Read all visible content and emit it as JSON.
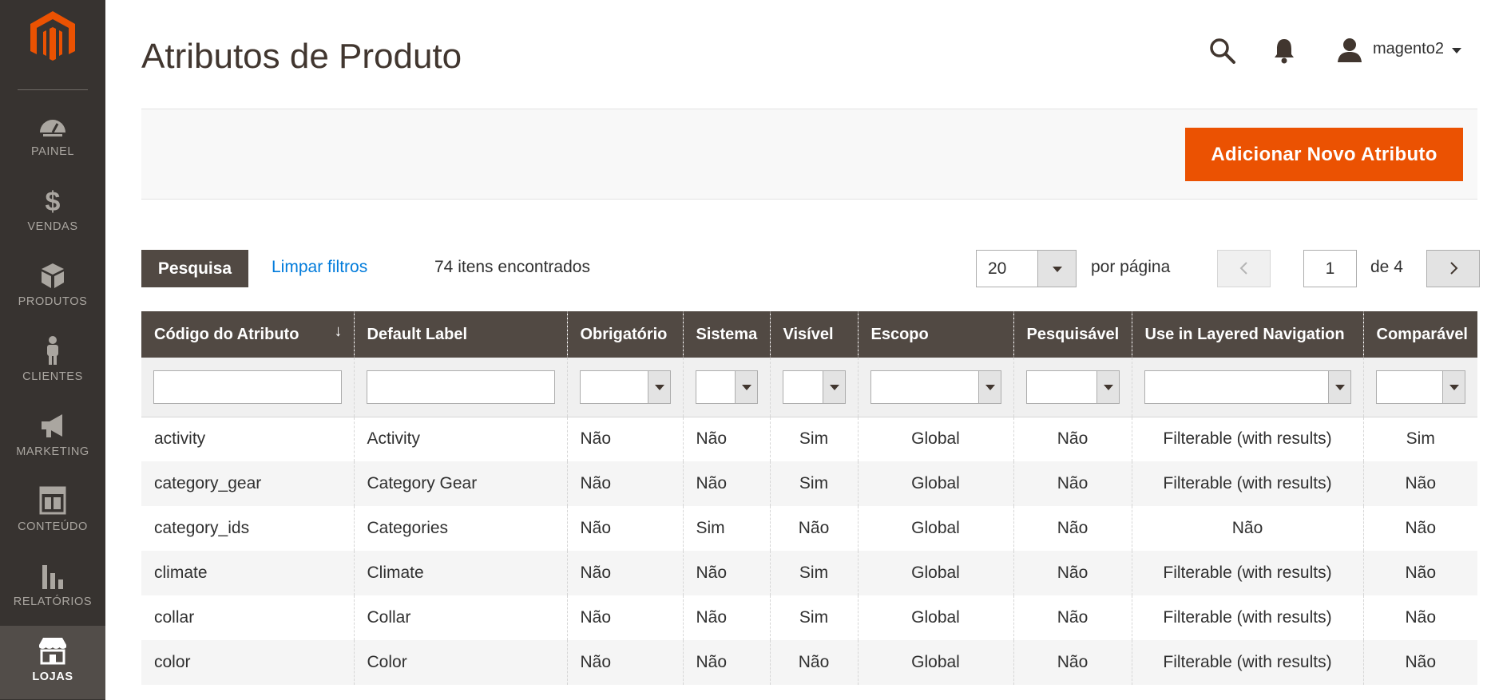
{
  "sidebar": {
    "items": [
      {
        "label": "PAINEL",
        "icon": "dashboard-icon"
      },
      {
        "label": "VENDAS",
        "icon": "dollar-icon"
      },
      {
        "label": "PRODUTOS",
        "icon": "cube-icon"
      },
      {
        "label": "CLIENTES",
        "icon": "person-icon"
      },
      {
        "label": "MARKETING",
        "icon": "megaphone-icon"
      },
      {
        "label": "CONTEÚDO",
        "icon": "layout-icon"
      },
      {
        "label": "RELATÓRIOS",
        "icon": "bar-chart-icon"
      },
      {
        "label": "LOJAS",
        "icon": "store-icon",
        "active": true
      }
    ]
  },
  "header": {
    "title": "Atributos de Produto",
    "username": "magento2"
  },
  "actions": {
    "add_button": "Adicionar Novo Atributo"
  },
  "toolbar": {
    "search_button": "Pesquisa",
    "clear_filters": "Limpar filtros",
    "records_found": "74 itens encontrados",
    "per_page_value": "20",
    "per_page_label": "por página",
    "current_page": "1",
    "total_pages": "de 4"
  },
  "table": {
    "columns": [
      "Código do Atributo",
      "Default Label",
      "Obrigatório",
      "Sistema",
      "Visível",
      "Escopo",
      "Pesquisável",
      "Use in Layered Navigation",
      "Comparável"
    ],
    "sort_indicator": "↓",
    "rows": [
      [
        "activity",
        "Activity",
        "Não",
        "Não",
        "Sim",
        "Global",
        "Não",
        "Filterable (with results)",
        "Sim"
      ],
      [
        "category_gear",
        "Category Gear",
        "Não",
        "Não",
        "Sim",
        "Global",
        "Não",
        "Filterable (with results)",
        "Não"
      ],
      [
        "category_ids",
        "Categories",
        "Não",
        "Sim",
        "Não",
        "Global",
        "Não",
        "Não",
        "Não"
      ],
      [
        "climate",
        "Climate",
        "Não",
        "Não",
        "Sim",
        "Global",
        "Não",
        "Filterable (with results)",
        "Não"
      ],
      [
        "collar",
        "Collar",
        "Não",
        "Não",
        "Sim",
        "Global",
        "Não",
        "Filterable (with results)",
        "Não"
      ],
      [
        "color",
        "Color",
        "Não",
        "Não",
        "Não",
        "Global",
        "Não",
        "Filterable (with results)",
        "Não"
      ]
    ]
  },
  "colors": {
    "accent": "#eb5202",
    "sidebar_bg": "#373330",
    "header_bg": "#514943",
    "link": "#007bdb"
  }
}
